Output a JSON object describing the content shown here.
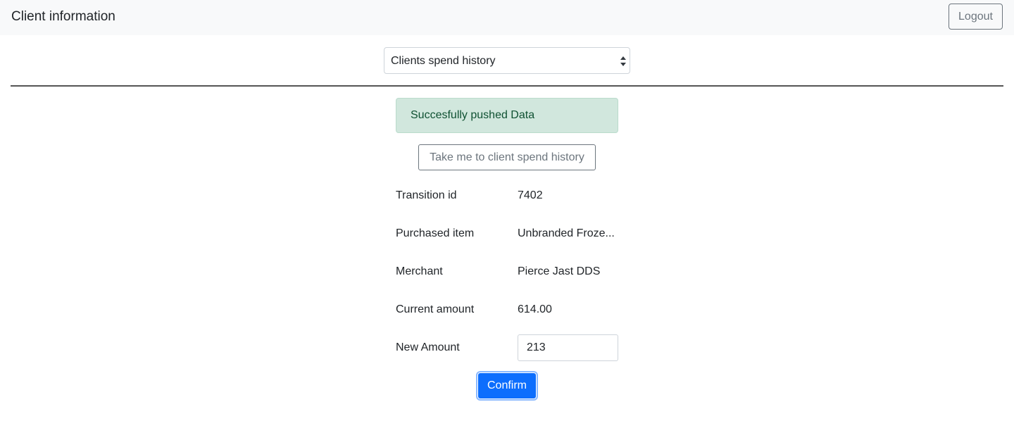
{
  "header": {
    "title": "Client information",
    "logout_label": "Logout"
  },
  "view_select": {
    "selected": "Clients spend history"
  },
  "alert": {
    "message": "Succesfully pushed Data",
    "color": "#d1e7dd"
  },
  "history_button": {
    "label": "Take me to client spend history"
  },
  "details": {
    "transition_id": {
      "label": "Transition id",
      "value": "7402"
    },
    "purchased_item": {
      "label": "Purchased item",
      "value": "Unbranded Froze..."
    },
    "merchant": {
      "label": "Merchant",
      "value": "Pierce Jast DDS"
    },
    "current_amount": {
      "label": "Current amount",
      "value": "614.00"
    },
    "new_amount": {
      "label": "New Amount",
      "value": "213"
    }
  },
  "confirm": {
    "label": "Confirm",
    "color": "#0d6efd"
  }
}
